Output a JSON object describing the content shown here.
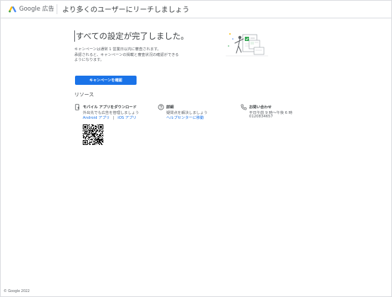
{
  "header": {
    "brand": "Google 広告",
    "tagline": "より多くのユーザーにリーチしましょう"
  },
  "main": {
    "title": "すべての設定が完了しました。",
    "description_lines": [
      "キャンペーンは通常 1 営業日以内に審査されます。",
      "承認されると、キャンペーンの掲載と審査状況の確認ができる",
      "ようになります。"
    ],
    "confirm_button": "キャンペーンを確認"
  },
  "resources": {
    "heading": "リソース",
    "mobile_app": {
      "title": "モバイル アプリをダウンロード",
      "description": "外出先でも広告を管理しましょう",
      "android_link": "Android アプリ",
      "separator": "|",
      "ios_link": "iOS アプリ",
      "icon": "phone-download-icon"
    },
    "details": {
      "title": "詳細",
      "description": "疑問点を解決しましょう",
      "help_link": "ヘルプセンターに移動",
      "icon": "help-circle-icon"
    },
    "contact": {
      "title": "お問い合わせ",
      "hours": "平日午前 9 時～午後 6 時",
      "phone": "0120834657",
      "icon": "phone-icon"
    }
  },
  "footer": {
    "copyright": "© Google 2022"
  },
  "colors": {
    "accent": "#1a73e8",
    "text": "#3c4043",
    "muted": "#5f6368",
    "logo_blue": "#4285f4",
    "logo_yellow": "#fbbc04",
    "logo_green": "#34a853"
  }
}
